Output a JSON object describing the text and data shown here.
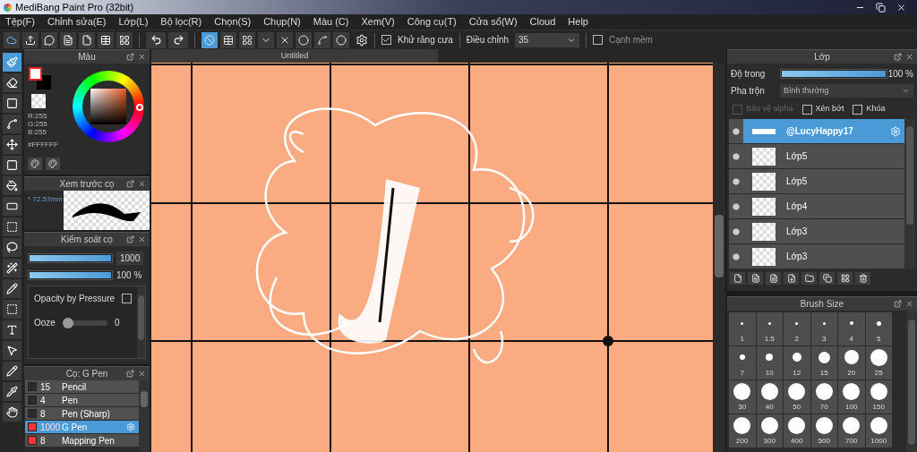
{
  "window": {
    "title": "MediBang Paint Pro (32bit)"
  },
  "menu": [
    "Tệp(F)",
    "Chỉnh sửa(E)",
    "Lớp(L)",
    "Bộ lọc(R)",
    "Chọn(S)",
    "Chụp(N)",
    "Màu (C)",
    "Xem(V)",
    "Công cụ(T)",
    "Cửa sổ(W)",
    "Cloud",
    "Help"
  ],
  "toolbar": {
    "snaps": [
      {
        "selected": true
      },
      {
        "selected": false
      },
      {
        "selected": false
      },
      {
        "selected": false
      },
      {
        "selected": false
      },
      {
        "selected": false
      },
      {
        "selected": false
      },
      {
        "selected": false
      }
    ],
    "antialias": {
      "label": "Khử răng cưa",
      "checked": true
    },
    "correction": {
      "label": "Điều chỉnh",
      "value": "35"
    },
    "soft_edge": {
      "label": "Cạnh mềm",
      "checked": false
    }
  },
  "tools": [
    {
      "selected": true
    },
    {
      "selected": false
    },
    {
      "selected": false
    },
    {
      "selected": false
    },
    {
      "selected": false
    },
    {
      "selected": false
    },
    {
      "selected": false
    },
    {
      "selected": false
    },
    {
      "selected": false
    },
    {
      "selected": false
    },
    {
      "selected": false
    },
    {
      "selected": false
    },
    {
      "selected": false
    },
    {
      "selected": false
    },
    {
      "selected": false
    },
    {
      "selected": false
    },
    {
      "selected": false
    },
    {
      "selected": false
    }
  ],
  "color_panel": {
    "title": "Màu",
    "r": "R:255",
    "g": "G:255",
    "b": "B:255",
    "hex": "#FFFFFF"
  },
  "brush_preview": {
    "title": "Xem trước cọ",
    "size": "* 72.57mm"
  },
  "brush_control": {
    "title": "Kiểm soát cọ",
    "size": {
      "level": 1,
      "reading": "1000"
    },
    "opacity": {
      "level": 1,
      "reading": "100 %"
    },
    "opacity_by_pressure": {
      "label": "Opacity by Pressure",
      "checked": false
    },
    "ooze": {
      "label": "Ooze",
      "level": 0,
      "reading": "0"
    }
  },
  "brushes": {
    "title": "Cọ: G Pen",
    "items": [
      {
        "size": "15",
        "name": "Pencil",
        "color": "#2b2b2b",
        "selected": false
      },
      {
        "size": "4",
        "name": "Pen",
        "color": "#2b2b2b",
        "selected": false
      },
      {
        "size": "8",
        "name": "Pen (Sharp)",
        "color": "#2b2b2b",
        "selected": false
      },
      {
        "size": "1000",
        "name": "G Pen",
        "color": "#ff3333",
        "selected": true
      },
      {
        "size": "8",
        "name": "Mapping Pen",
        "color": "#ff3333",
        "selected": false
      }
    ]
  },
  "canvas": {
    "tab": "Untitled"
  },
  "layers": {
    "title": "Lớp",
    "opacity": {
      "label": "Độ trong",
      "level": 1,
      "reading": "100 %"
    },
    "blend": {
      "label": "Pha trộn",
      "value": "Bình thường"
    },
    "options": [
      {
        "label": "Bảo vệ alpha",
        "checked": false,
        "disabled": true
      },
      {
        "label": "Xén bớt",
        "checked": false,
        "disabled": false
      },
      {
        "label": "Khóa",
        "checked": false,
        "disabled": false
      }
    ],
    "items": [
      {
        "name": "@LucyHappy17",
        "selected": true
      },
      {
        "name": "Lớp5",
        "selected": false
      },
      {
        "name": "Lớp5",
        "selected": false
      },
      {
        "name": "Lớp4",
        "selected": false
      },
      {
        "name": "Lớp3",
        "selected": false
      },
      {
        "name": "Lớp3",
        "selected": false
      }
    ]
  },
  "brush_size": {
    "title": "Brush Size",
    "sizes": [
      "1",
      "1.5",
      "2",
      "3",
      "4",
      "5",
      "7",
      "10",
      "12",
      "15",
      "20",
      "25",
      "30",
      "40",
      "50",
      "70",
      "100",
      "150",
      "200",
      "300",
      "400",
      "500",
      "700",
      "1000"
    ]
  }
}
